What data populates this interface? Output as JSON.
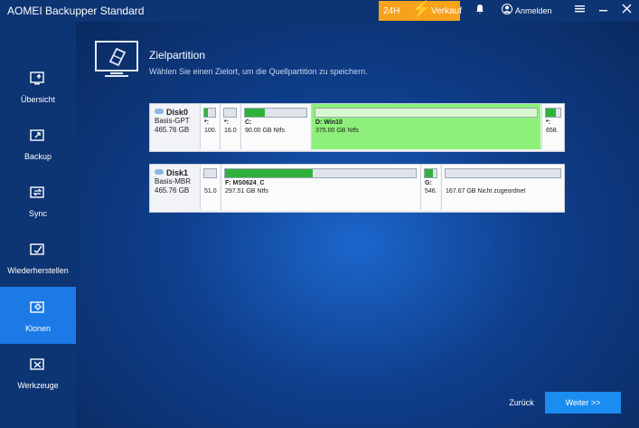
{
  "app": {
    "title": "AOMEI Backupper Standard"
  },
  "promo": {
    "badge": "24H",
    "label": "Verkauf"
  },
  "header": {
    "login_label": "Anmelden"
  },
  "sidebar": {
    "items": [
      {
        "label": "Übersicht",
        "icon": "overview-icon"
      },
      {
        "label": "Backup",
        "icon": "backup-icon"
      },
      {
        "label": "Sync",
        "icon": "sync-icon"
      },
      {
        "label": "Wiederherstellen",
        "icon": "restore-icon"
      },
      {
        "label": "Klonen",
        "icon": "clone-icon",
        "active": true
      },
      {
        "label": "Werkzeuge",
        "icon": "tools-icon"
      }
    ]
  },
  "main": {
    "title": "Zielpartition",
    "subtitle": "Wählen Sie einen Zielort, um die Quellpartition zu speichern.",
    "disks": [
      {
        "name": "Disk0",
        "type": "Basis-GPT",
        "size": "465.76 GB",
        "partitions": [
          {
            "name": "*:",
            "size": "100.",
            "used": 0.35
          },
          {
            "name": "*:",
            "size": "16.0",
            "used": 0.0
          },
          {
            "name": "C:",
            "size": "90.00 GB Ntfs",
            "used": 0.32
          },
          {
            "name": "D: Win10",
            "size": "375.00 GB Ntfs",
            "used": 0.0,
            "selected": true
          },
          {
            "name": "*:",
            "size": "658.",
            "used": 0.7
          }
        ]
      },
      {
        "name": "Disk1",
        "type": "Basis-MBR",
        "size": "465.76 GB",
        "partitions": [
          {
            "name": "",
            "size": "51.0",
            "used": 0.0
          },
          {
            "name": "F: MS0624_C",
            "size": "297.51 GB Ntfs",
            "used": 0.46
          },
          {
            "name": "G:",
            "size": "546.",
            "used": 0.7
          },
          {
            "name": "",
            "size": "167.67 GB Nicht zugeordnet",
            "used": 0.0
          }
        ]
      }
    ]
  },
  "footer": {
    "back_label": "Zurück",
    "next_label": "Weiter >>"
  }
}
